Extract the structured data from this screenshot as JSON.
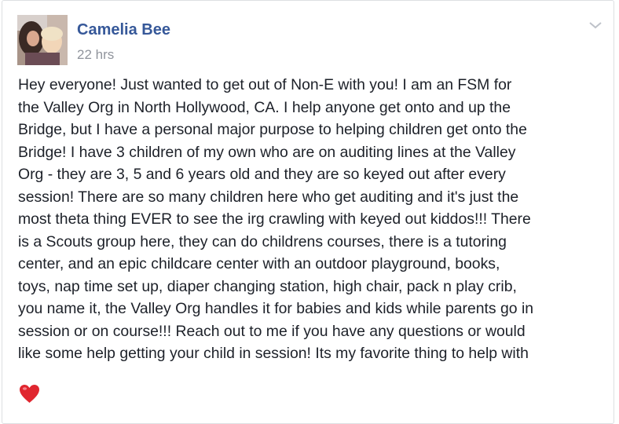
{
  "post": {
    "author": "Camelia Bee",
    "timestamp": "22 hrs",
    "body_lines": [
      "Hey everyone! Just wanted to get out of Non-E with you! I am an FSM for",
      "the Valley Org in North Hollywood, CA. I help anyone get onto and up the",
      "Bridge, but I have a personal major purpose to helping children get onto the",
      "Bridge! I have 3 children of my own who are on auditing lines at the Valley",
      "Org - they are 3, 5 and 6 years old and they are so keyed out after every",
      "session! There are so many children here who get auditing and it's just the",
      "most theta thing EVER to see the irg crawling with keyed out kiddos!!! There",
      "is a Scouts group here, they can do childrens courses, there is a tutoring",
      "center, and an epic childcare center with an outdoor playground, books,",
      "toys, nap time set up, diaper changing station, high chair, pack n play crib,",
      "you name it, the Valley Org handles it for babies and kids while parents go in",
      "session or on course!!! Reach out to me if you have any questions or would",
      "like some help getting your child in session! Its my favorite thing to help with"
    ],
    "emoji": "heart-emoji"
  },
  "icons": {
    "menu": "chevron-down-icon",
    "avatar": "profile-photo"
  },
  "colors": {
    "author_link": "#365899",
    "timestamp": "#90949c",
    "body_text": "#1d2129",
    "heart": "#e0262f",
    "card_border": "#dddfe2"
  }
}
